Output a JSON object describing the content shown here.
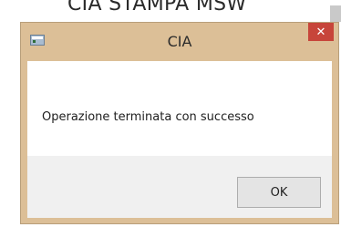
{
  "background_window": {
    "title": "CIA STAMPA MSW"
  },
  "dialog": {
    "title": "CIA",
    "close_label": "✕",
    "message": "Operazione terminata con successo",
    "ok_label": "OK"
  },
  "colors": {
    "frame": "#dcbf97",
    "close_button": "#c7453a",
    "content_background": "#ffffff",
    "button_area_background": "#f0f0f0"
  },
  "icons": {
    "app_icon": "app-window-icon",
    "close_icon": "close-icon"
  }
}
